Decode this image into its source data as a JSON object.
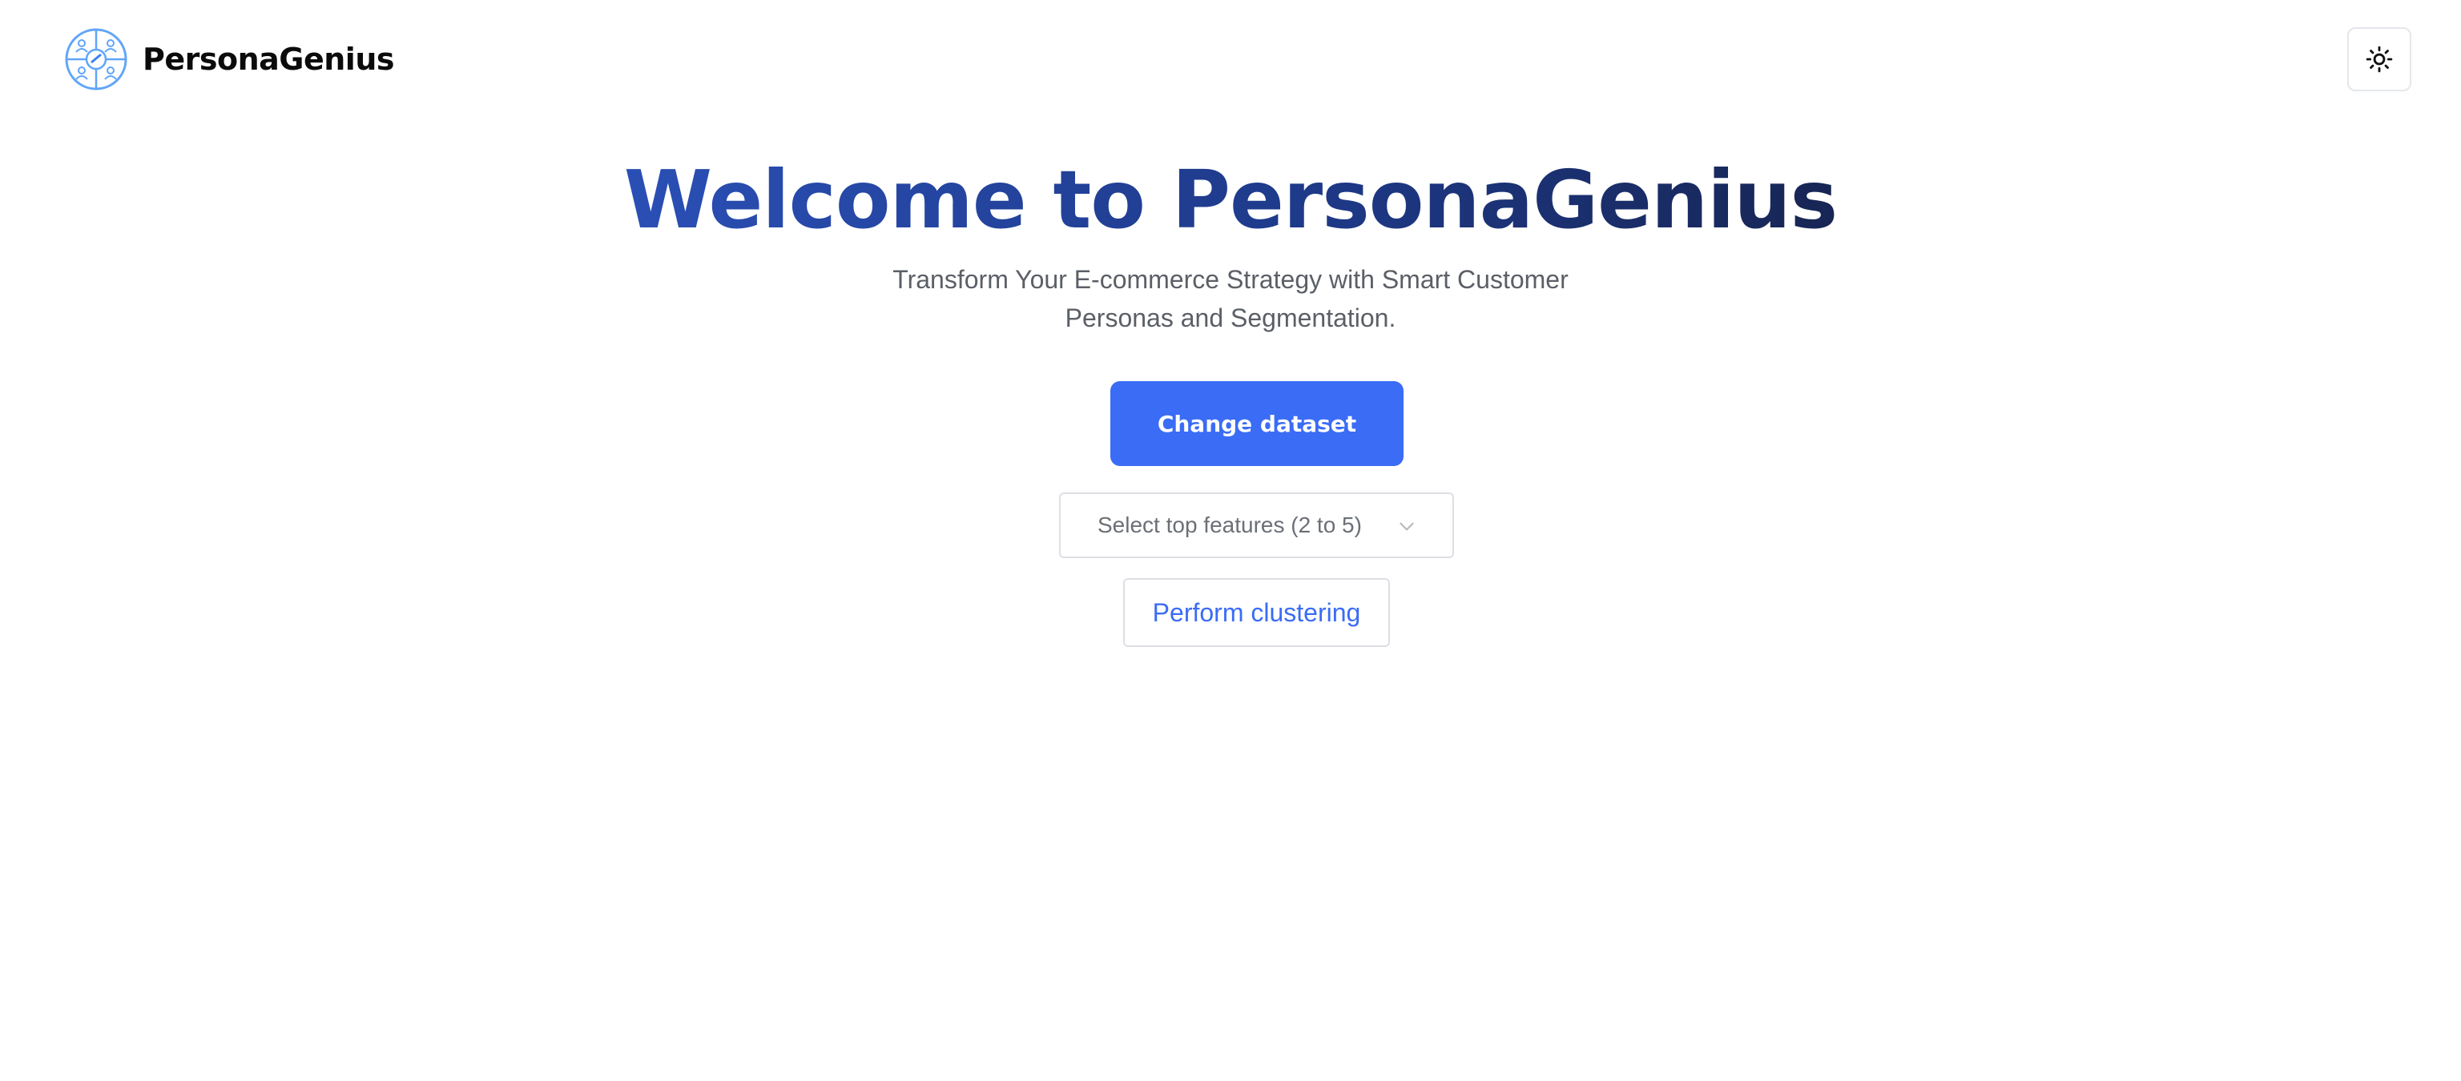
{
  "app": {
    "brand_name": "PersonaGenius",
    "accent_color": "#3b6cf5",
    "title_gradient": [
      "#2a4fb5",
      "#172554"
    ]
  },
  "navbar": {
    "logo_icon": "persona-logo-icon",
    "theme_toggle_icon": "sun-icon"
  },
  "hero": {
    "title": "Welcome to PersonaGenius",
    "subtitle": "Transform Your E-commerce Strategy with Smart Customer Personas and Segmentation."
  },
  "actions": {
    "change_dataset_label": "Change dataset",
    "feature_select_placeholder": "Select top features (2 to 5)",
    "feature_select_icon": "chevron-down-icon",
    "perform_clustering_label": "Perform clustering"
  }
}
